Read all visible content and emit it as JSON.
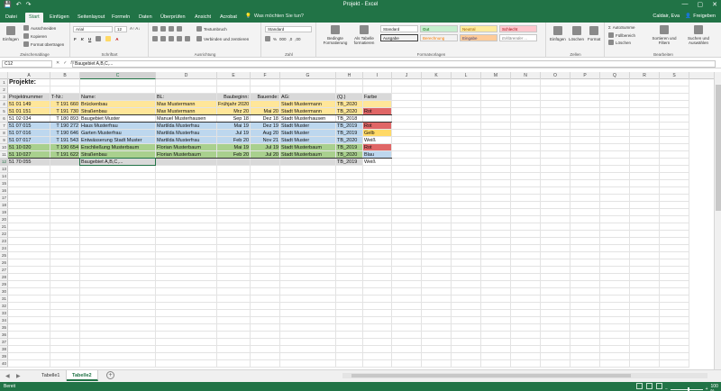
{
  "window": {
    "title": "Projekt - Excel",
    "min": "—",
    "max": "▢",
    "close": "✕"
  },
  "quickaccess": {
    "save": "💾",
    "undo": "↶",
    "redo": "↷"
  },
  "tabs": [
    {
      "label": "Datei"
    },
    {
      "label": "Start"
    },
    {
      "label": "Einfügen"
    },
    {
      "label": "Seitenlayout"
    },
    {
      "label": "Formeln"
    },
    {
      "label": "Daten"
    },
    {
      "label": "Überprüfen"
    },
    {
      "label": "Ansicht"
    },
    {
      "label": "Acrobat"
    }
  ],
  "tell_me": "Was möchten Sie tun?",
  "user": "Caldair, Eva",
  "share": "Freigeben",
  "ribbon": {
    "clipboard": {
      "paste": "Einfügen",
      "cut": "Ausschneiden",
      "copy": "Kopieren",
      "format_painter": "Format übertragen",
      "label": "Zwischenablage"
    },
    "font": {
      "name": "Arial",
      "size": "12",
      "label": "Schriftart"
    },
    "alignment": {
      "wrap": "Textumbruch",
      "merge": "Verbinden und zentrieren",
      "label": "Ausrichtung"
    },
    "number": {
      "format": "Standard",
      "label": "Zahl"
    },
    "styles": {
      "cond": "Bedingte Formatierung",
      "table": "Als Tabelle formatieren",
      "cells": [
        "Standard",
        "Gut",
        "Neutral",
        "Schlecht",
        "Ausgabe",
        "Berechnung",
        "Eingabe",
        "Erklärender ..."
      ],
      "label": "Formatvorlagen"
    },
    "cells_grp": {
      "insert": "Einfügen",
      "delete": "Löschen",
      "format": "Format",
      "label": "Zellen"
    },
    "editing": {
      "autosum": "AutoSumme",
      "fill": "Füllbereich",
      "clear": "Löschen",
      "sort": "Sortieren und Filtern",
      "find": "Suchen und Auswählen",
      "label": "Bearbeiten"
    }
  },
  "formula": {
    "namebox": "C12",
    "content": "Baugebiet A,B,C,..."
  },
  "columns": [
    "A",
    "B",
    "C",
    "D",
    "E",
    "F",
    "G",
    "H",
    "I",
    "J",
    "K",
    "L",
    "M",
    "N",
    "O",
    "P",
    "Q",
    "R",
    "S"
  ],
  "rows": [
    "1",
    "2",
    "3",
    "4",
    "5",
    "6",
    "7",
    "8",
    "9",
    "10",
    "11",
    "12",
    "13",
    "14",
    "15",
    "16",
    "17",
    "18",
    "19",
    "20",
    "21",
    "22",
    "23",
    "24",
    "25",
    "26",
    "27",
    "28",
    "29",
    "30",
    "31",
    "32",
    "33",
    "34",
    "35",
    "36",
    "37",
    "38",
    "39",
    "40"
  ],
  "title": "Projekte:",
  "headers": [
    "Projektnummer",
    "T-Nr.:",
    "Name:",
    "BL:",
    "Baubeginn:",
    "Bauende:",
    "AG:",
    "(Q.)",
    "Farbe"
  ],
  "data_rows": [
    {
      "cells": [
        "51 01 149",
        "T 191 660",
        "Brückenbau",
        "Max Mustermann",
        "Frühjahr 2020",
        "",
        "Stadt Mustermann",
        "TB_2020",
        ""
      ],
      "color": "#ffe699",
      "farbe_color": ""
    },
    {
      "cells": [
        "51 01 151",
        "T 191 730",
        "Straßenbau",
        "Max Mustermann",
        "Mrz 20",
        "Mai 20",
        "Stadt Mustermann",
        "TB_2020",
        "Rot"
      ],
      "color": "#ffe699",
      "farbe_color": "#e06666"
    },
    {
      "cells": [
        "51 02 034",
        "T 180 893",
        "Baugebiet Muster",
        "Manuel Musterhausen",
        "Sep 18",
        "Dez 18",
        "Stadt Musterhausen",
        "TB_2018",
        ""
      ],
      "color": "#ffffff",
      "farbe_color": ""
    },
    {
      "cells": [
        "51 07 015",
        "T 190 272",
        "Haus Musterfrau",
        "Martilda Musterfrau",
        "Mai 19",
        "Dez 19",
        "Stadt Muster",
        "TB_2019",
        "Rot"
      ],
      "color": "#bdd7ee",
      "farbe_color": "#e06666"
    },
    {
      "cells": [
        "51 07 016",
        "T 190 646",
        "Garten Musterfrau",
        "Martilda Musterfrau",
        "Jul 19",
        "Aug 20",
        "Stadt Muster",
        "TB_2019",
        "Gelb"
      ],
      "color": "#bdd7ee",
      "farbe_color": "#ffd966"
    },
    {
      "cells": [
        "51 07 017",
        "T 191 543",
        "Entwässerung Stadt Muster",
        "Martilda Musterfrau",
        "Feb 20",
        "Nov 21",
        "Stadt Muster",
        "TB_2020",
        "Weiß"
      ],
      "color": "#bdd7ee",
      "farbe_color": "#ffffff"
    },
    {
      "cells": [
        "51 10 020",
        "T 190 654",
        "Erschließung Musterbaum",
        "Florian Musterbaum",
        "Mai 19",
        "Jul 19",
        "Stadt Musterbaum",
        "TB_2019",
        "Rot"
      ],
      "color": "#a9d08e",
      "farbe_color": "#e06666"
    },
    {
      "cells": [
        "51 10 027",
        "T 191 622",
        "Straßenbau",
        "Florian Musterbaum",
        "Feb 20",
        "Jul 20",
        "Stadt Musterbaum",
        "TB_2020",
        "Blau"
      ],
      "color": "#a9d08e",
      "farbe_color": "#bdd7ee"
    },
    {
      "cells": [
        "51 70 055",
        "",
        "Baugebiet A,B,C,...",
        "",
        "",
        "",
        "",
        "TB_2019",
        "Weiß"
      ],
      "color": "#d9d9d9",
      "farbe_color": "#ffffff"
    }
  ],
  "sheets": [
    {
      "label": "Tabelle1"
    },
    {
      "label": "Tabelle2"
    }
  ],
  "status": {
    "ready": "Bereit",
    "zoom": "100 %"
  }
}
